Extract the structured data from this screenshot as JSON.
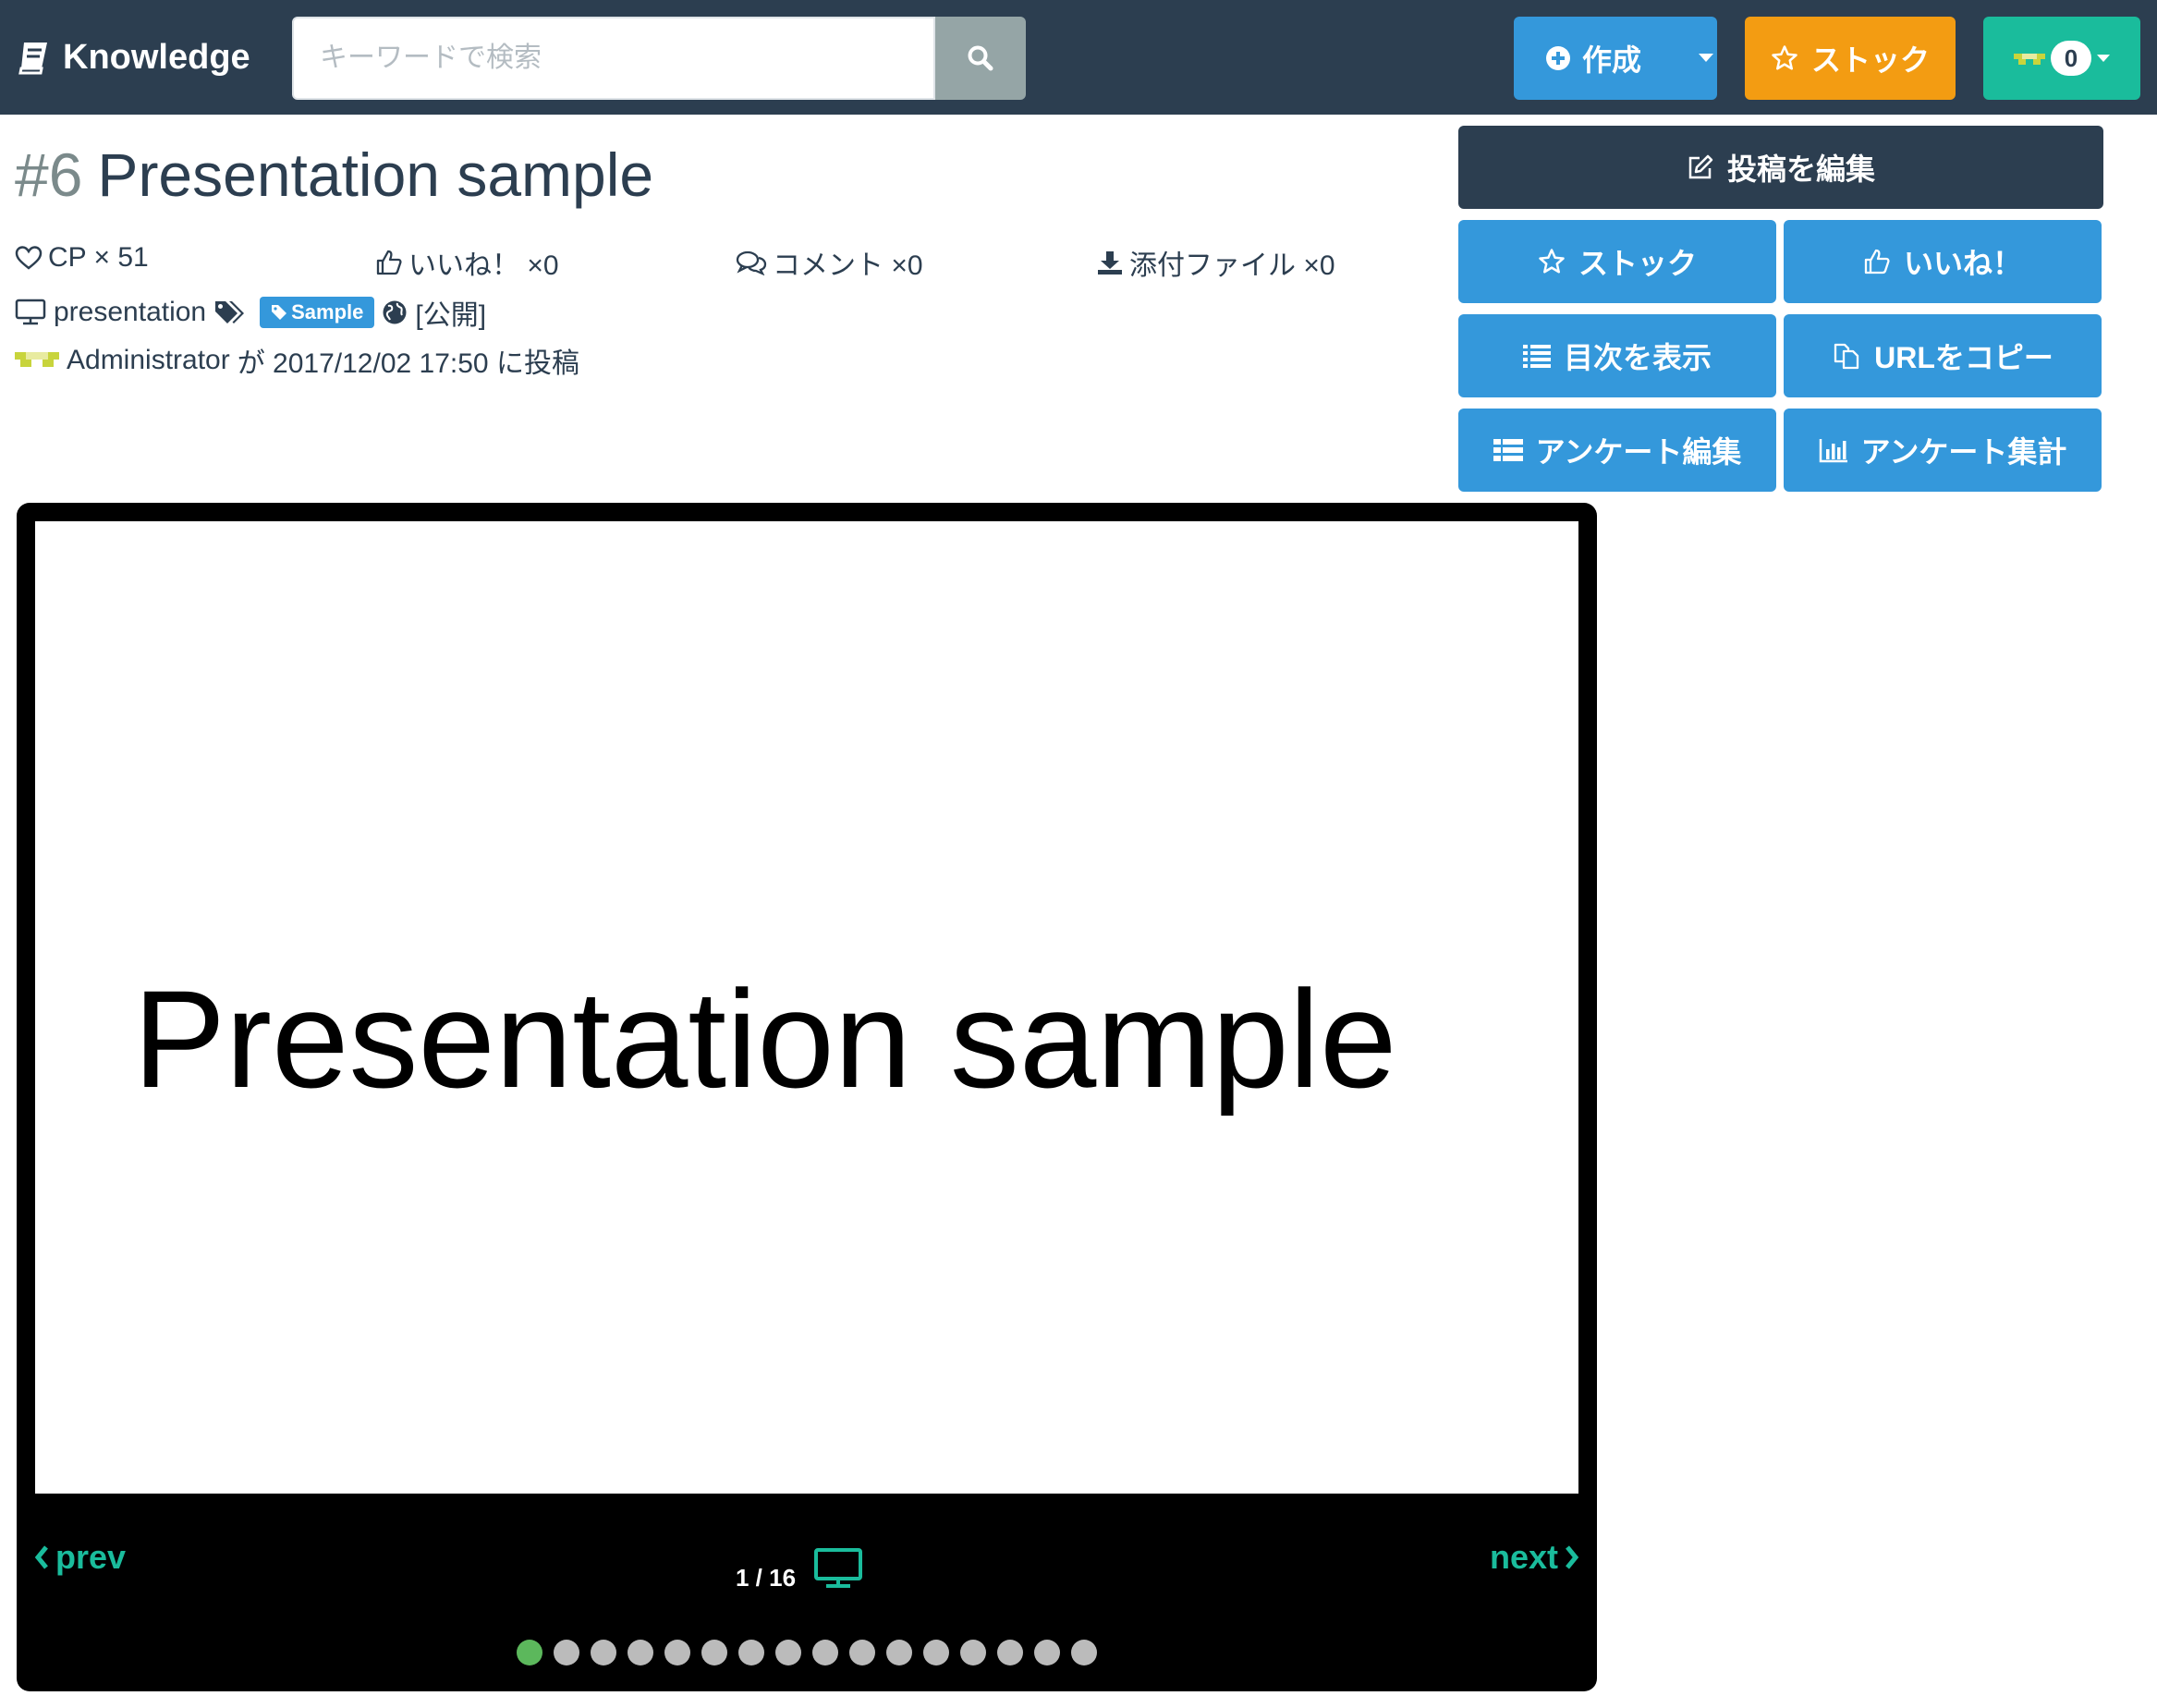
{
  "navbar": {
    "brand": "Knowledge",
    "search_placeholder": "キーワードで検索",
    "create_label": "作成",
    "stock_label": "ストック",
    "notification_count": "0"
  },
  "article": {
    "number": "#6",
    "title": "Presentation sample",
    "cp_label": "CP × 51",
    "like_label": "いいね！ ×0",
    "comment_label": "コメント ×0",
    "attachment_label": "添付ファイル ×0",
    "type_label": "presentation",
    "tag": "Sample",
    "visibility": "[公開]",
    "author": "Administrator",
    "posted_text": "が 2017/12/02 17:50 に投稿"
  },
  "actions": {
    "edit": "投稿を編集",
    "stock": "ストック",
    "like": "いいね！",
    "toc": "目次を表示",
    "copy_url": "URLをコピー",
    "survey_edit": "アンケート編集",
    "survey_result": "アンケート集計"
  },
  "slideshow": {
    "slide_text": "Presentation sample",
    "prev": "prev",
    "next": "next",
    "counter": "1 / 16",
    "current_page": 1,
    "total_pages": 16
  },
  "colors": {
    "navbar": "#2c3e50",
    "primary": "#3498db",
    "warning": "#f39c12",
    "success": "#1abc9c",
    "active_dot": "#5cb85c"
  }
}
